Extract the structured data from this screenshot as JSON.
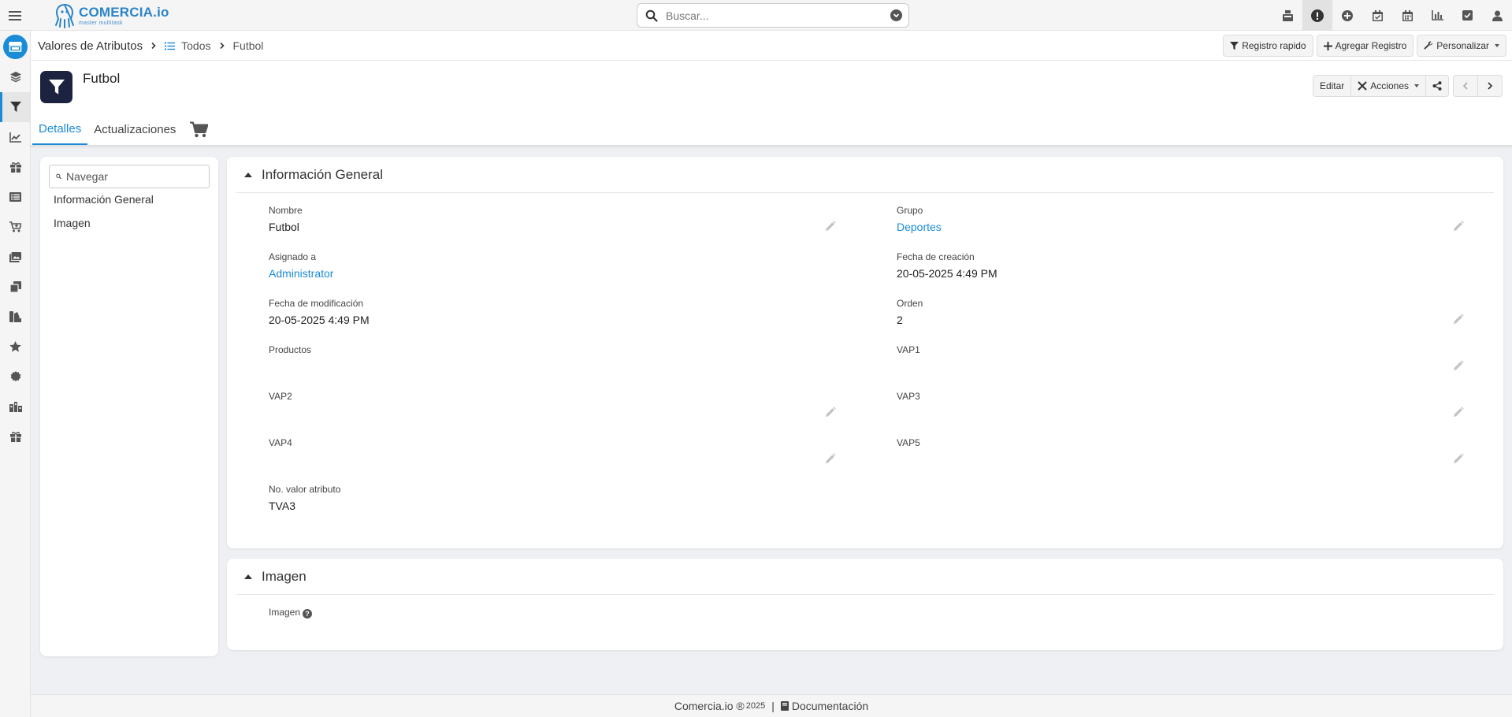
{
  "app": {
    "name": "COMERCIA.io",
    "tagline": "master multitask"
  },
  "search": {
    "placeholder": "Buscar..."
  },
  "breadcrumb": {
    "module": "Valores de Atributos",
    "list": "Todos",
    "current": "Futbol"
  },
  "header_actions": {
    "quick": "Registro rapido",
    "add": "Agregar Registro",
    "customize": "Personalizar"
  },
  "record": {
    "title": "Futbol",
    "edit": "Editar",
    "actions": "Acciones",
    "tabs": {
      "details": "Detalles",
      "updates": "Actualizaciones"
    }
  },
  "nav": {
    "placeholder": "Navegar",
    "items": [
      "Información General",
      "Imagen"
    ]
  },
  "general": {
    "title": "Información General",
    "fields": {
      "nombre": {
        "label": "Nombre",
        "value": "Futbol"
      },
      "grupo": {
        "label": "Grupo",
        "value": "Deportes"
      },
      "asignado": {
        "label": "Asignado a",
        "value": "Administrator"
      },
      "fecha_creacion": {
        "label": "Fecha de creación",
        "value": "20-05-2025 4:49 PM"
      },
      "fecha_modificacion": {
        "label": "Fecha de modificación",
        "value": "20-05-2025 4:49 PM"
      },
      "orden": {
        "label": "Orden",
        "value": "2"
      },
      "productos": {
        "label": "Productos",
        "value": ""
      },
      "vap1": {
        "label": "VAP1",
        "value": ""
      },
      "vap2": {
        "label": "VAP2",
        "value": ""
      },
      "vap3": {
        "label": "VAP3",
        "value": ""
      },
      "vap4": {
        "label": "VAP4",
        "value": ""
      },
      "vap5": {
        "label": "VAP5",
        "value": ""
      },
      "no_valor": {
        "label": "No. valor atributo",
        "value": "TVA3"
      }
    }
  },
  "image_panel": {
    "title": "Imagen",
    "field_label": "Imagen",
    "help": "?"
  },
  "footer": {
    "brand": "Comercia.io",
    "copyright": "®",
    "year": "2025",
    "pipe": "|",
    "doc": "Documentación"
  },
  "colors": {
    "accent": "#1a8bd6",
    "icon_bg": "#1c2340"
  }
}
